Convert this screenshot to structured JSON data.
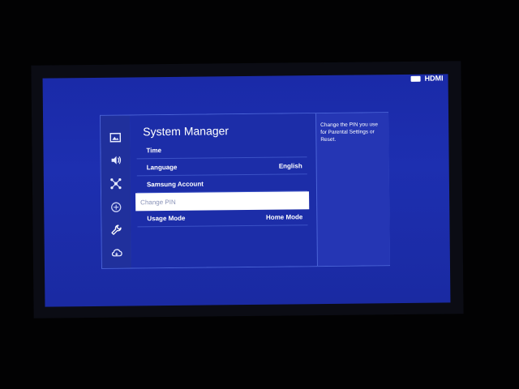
{
  "source": {
    "label": "HDMI",
    "icon": "input-source-icon"
  },
  "panel": {
    "title": "System Manager",
    "help_text": "Change the PIN you use for Parental Settings or Reset.",
    "menu_items": [
      {
        "label": "Time",
        "value": ""
      },
      {
        "label": "Language",
        "value": "English"
      },
      {
        "label": "Samsung Account",
        "value": ""
      },
      {
        "label": "Change PIN",
        "value": "",
        "selected": true
      },
      {
        "label": "Usage Mode",
        "value": "Home Mode"
      }
    ]
  },
  "side_rail": {
    "icons": [
      "picture-icon",
      "sound-icon",
      "connection-icon",
      "broadcasting-icon",
      "support-wrench-icon",
      "cloud-icon"
    ]
  },
  "colors": {
    "screen_bg": "#1d2fb0",
    "panel_bg": "#1c2da8",
    "selected_bg": "#ffffff",
    "selected_text": "#8a93b8"
  }
}
